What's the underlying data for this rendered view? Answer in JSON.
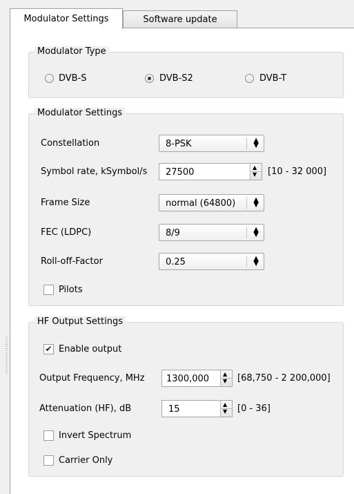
{
  "tabs": [
    {
      "label": "Modulator Settings",
      "active": true
    },
    {
      "label": "Software update",
      "active": false
    }
  ],
  "modulator_type": {
    "title": "Modulator Type",
    "options": [
      "DVB-S",
      "DVB-S2",
      "DVB-T"
    ],
    "selected": "DVB-S2"
  },
  "modulator_settings": {
    "title": "Modulator Settings",
    "constellation": {
      "label": "Constellation",
      "value": "8-PSK"
    },
    "symbol_rate": {
      "label": "Symbol rate, kSymbol/s",
      "value": "27500",
      "range": "[10 - 32 000]"
    },
    "frame_size": {
      "label": "Frame Size",
      "value": "normal (64800)"
    },
    "fec": {
      "label": "FEC (LDPC)",
      "value": "8/9"
    },
    "rolloff": {
      "label": "Roll-off-Factor",
      "value": "0.25"
    },
    "pilots": {
      "label": "Pilots",
      "checked": false
    }
  },
  "hf_output": {
    "title": "HF Output Settings",
    "enable_output": {
      "label": "Enable output",
      "checked": true
    },
    "frequency": {
      "label": "Output Frequency, MHz",
      "value": "1300,000",
      "range": "[68,750 - 2 200,000]"
    },
    "attenuation": {
      "label": "Attenuation (HF), dB",
      "value": "15",
      "range": "[0 - 36]"
    },
    "invert_spectrum": {
      "label": "Invert Spectrum",
      "checked": false
    },
    "carrier_only": {
      "label": "Carrier Only",
      "checked": false
    }
  },
  "icons": {
    "check": "✔",
    "updown": "▲▼"
  }
}
